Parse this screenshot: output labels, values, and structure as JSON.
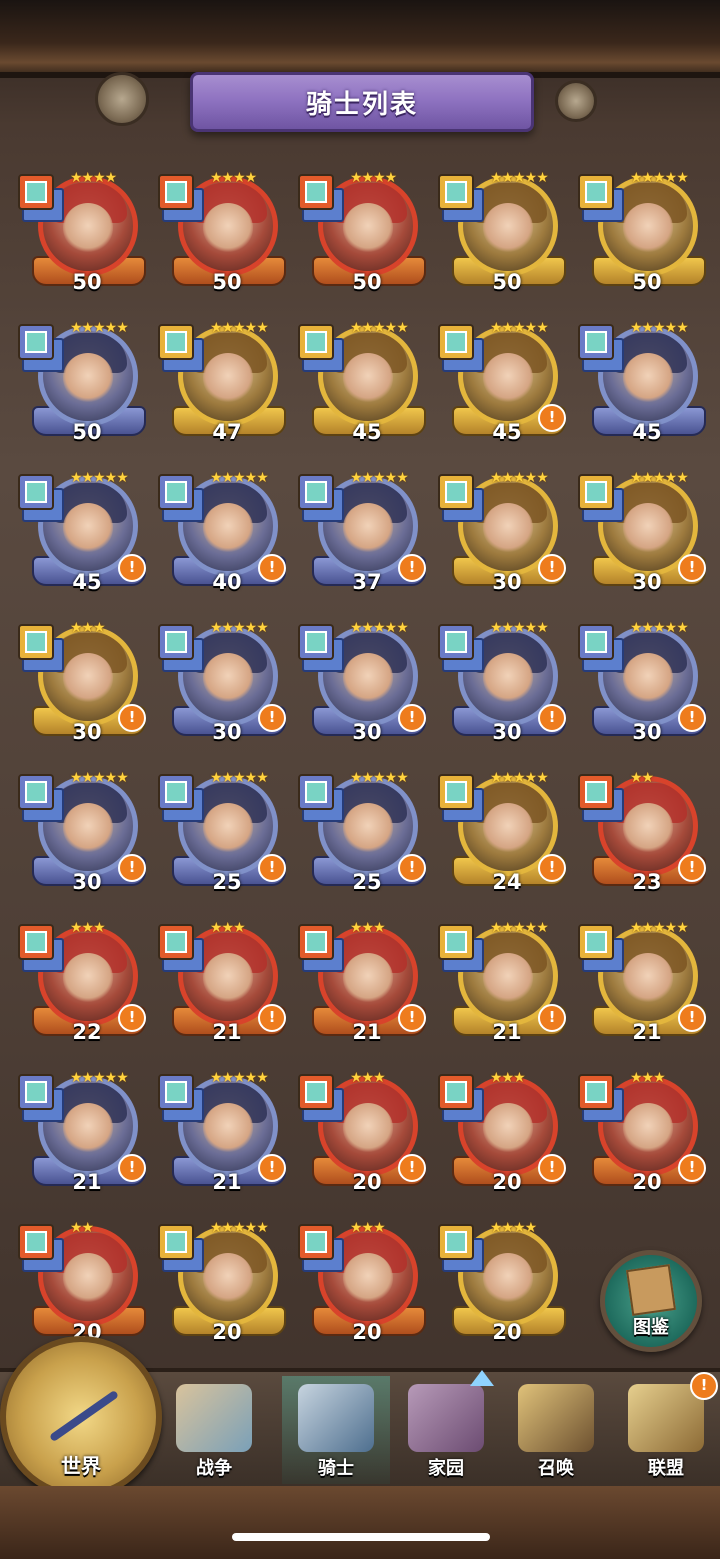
{
  "header": {
    "title": "骑士列表"
  },
  "knights": [
    {
      "level": "50",
      "stars": "★★★★",
      "frame": "red",
      "role_color": "c-red",
      "alert": false
    },
    {
      "level": "50",
      "stars": "★★★★",
      "frame": "red",
      "role_color": "c-red",
      "alert": false
    },
    {
      "level": "50",
      "stars": "★★★★",
      "frame": "red",
      "role_color": "c-red",
      "alert": false
    },
    {
      "level": "50",
      "stars": "★★★★★",
      "frame": "gold",
      "role_color": "c-gold",
      "alert": false
    },
    {
      "level": "50",
      "stars": "★★★★★",
      "frame": "gold",
      "role_color": "c-gold",
      "alert": false
    },
    {
      "level": "50",
      "stars": "★★★★★",
      "frame": "blue",
      "role_color": "c-blue",
      "alert": false
    },
    {
      "level": "47",
      "stars": "★★★★★",
      "frame": "gold",
      "role_color": "c-gold",
      "alert": false
    },
    {
      "level": "45",
      "stars": "★★★★★",
      "frame": "gold",
      "role_color": "c-gold",
      "alert": false
    },
    {
      "level": "45",
      "stars": "★★★★★",
      "frame": "gold",
      "role_color": "c-gold",
      "alert": true
    },
    {
      "level": "45",
      "stars": "★★★★★",
      "frame": "blue",
      "role_color": "c-blue",
      "alert": false
    },
    {
      "level": "45",
      "stars": "★★★★★",
      "frame": "blue",
      "role_color": "c-blue",
      "alert": true
    },
    {
      "level": "40",
      "stars": "★★★★★",
      "frame": "blue",
      "role_color": "c-blue",
      "alert": true
    },
    {
      "level": "37",
      "stars": "★★★★★",
      "frame": "blue",
      "role_color": "c-blue",
      "alert": true
    },
    {
      "level": "30",
      "stars": "★★★★★",
      "frame": "gold",
      "role_color": "c-gold",
      "alert": true
    },
    {
      "level": "30",
      "stars": "★★★★★",
      "frame": "gold",
      "role_color": "c-gold",
      "alert": true
    },
    {
      "level": "30",
      "stars": "★★★",
      "frame": "gold",
      "role_color": "c-gold",
      "alert": true
    },
    {
      "level": "30",
      "stars": "★★★★★",
      "frame": "blue",
      "role_color": "c-blue",
      "alert": true
    },
    {
      "level": "30",
      "stars": "★★★★★",
      "frame": "blue",
      "role_color": "c-blue",
      "alert": true
    },
    {
      "level": "30",
      "stars": "★★★★★",
      "frame": "blue",
      "role_color": "c-blue",
      "alert": true
    },
    {
      "level": "30",
      "stars": "★★★★★",
      "frame": "blue",
      "role_color": "c-blue",
      "alert": true
    },
    {
      "level": "30",
      "stars": "★★★★★",
      "frame": "blue",
      "role_color": "c-blue",
      "alert": true
    },
    {
      "level": "25",
      "stars": "★★★★★",
      "frame": "blue",
      "role_color": "c-blue",
      "alert": true
    },
    {
      "level": "25",
      "stars": "★★★★★",
      "frame": "blue",
      "role_color": "c-blue",
      "alert": true
    },
    {
      "level": "24",
      "stars": "★★★★★",
      "frame": "gold",
      "role_color": "c-gold",
      "alert": true
    },
    {
      "level": "23",
      "stars": "★★",
      "frame": "red",
      "role_color": "c-red",
      "alert": true
    },
    {
      "level": "22",
      "stars": "★★★",
      "frame": "red",
      "role_color": "c-red",
      "alert": true
    },
    {
      "level": "21",
      "stars": "★★★",
      "frame": "red",
      "role_color": "c-red",
      "alert": true
    },
    {
      "level": "21",
      "stars": "★★★",
      "frame": "red",
      "role_color": "c-red",
      "alert": true
    },
    {
      "level": "21",
      "stars": "★★★★★",
      "frame": "gold",
      "role_color": "c-gold",
      "alert": true
    },
    {
      "level": "21",
      "stars": "★★★★★",
      "frame": "gold",
      "role_color": "c-gold",
      "alert": true
    },
    {
      "level": "21",
      "stars": "★★★★★",
      "frame": "blue",
      "role_color": "c-blue",
      "alert": true
    },
    {
      "level": "21",
      "stars": "★★★★★",
      "frame": "blue",
      "role_color": "c-blue",
      "alert": true
    },
    {
      "level": "20",
      "stars": "★★★",
      "frame": "red",
      "role_color": "c-red",
      "alert": true
    },
    {
      "level": "20",
      "stars": "★★★",
      "frame": "red",
      "role_color": "c-red",
      "alert": true
    },
    {
      "level": "20",
      "stars": "★★★",
      "frame": "red",
      "role_color": "c-red",
      "alert": true
    },
    {
      "level": "20",
      "stars": "★★",
      "frame": "red",
      "role_color": "c-red",
      "alert": false
    },
    {
      "level": "20",
      "stars": "★★★★★",
      "frame": "gold",
      "role_color": "c-gold",
      "alert": false
    },
    {
      "level": "20",
      "stars": "★★★",
      "frame": "red",
      "role_color": "c-red",
      "alert": false
    },
    {
      "level": "20",
      "stars": "★★★★",
      "frame": "gold",
      "role_color": "c-gold",
      "alert": false
    }
  ],
  "codex": {
    "label": "图鉴",
    "icon": "book-icon"
  },
  "nav": {
    "world": "世界",
    "items": [
      {
        "label": "战争",
        "icon": "map-icon"
      },
      {
        "label": "骑士",
        "icon": "wizard-icon",
        "active": true
      },
      {
        "label": "家园",
        "icon": "tent-icon"
      },
      {
        "label": "召唤",
        "icon": "train-icon"
      },
      {
        "label": "联盟",
        "icon": "castle-icon"
      }
    ],
    "alert_symbol": "!"
  },
  "alert_symbol": "!"
}
